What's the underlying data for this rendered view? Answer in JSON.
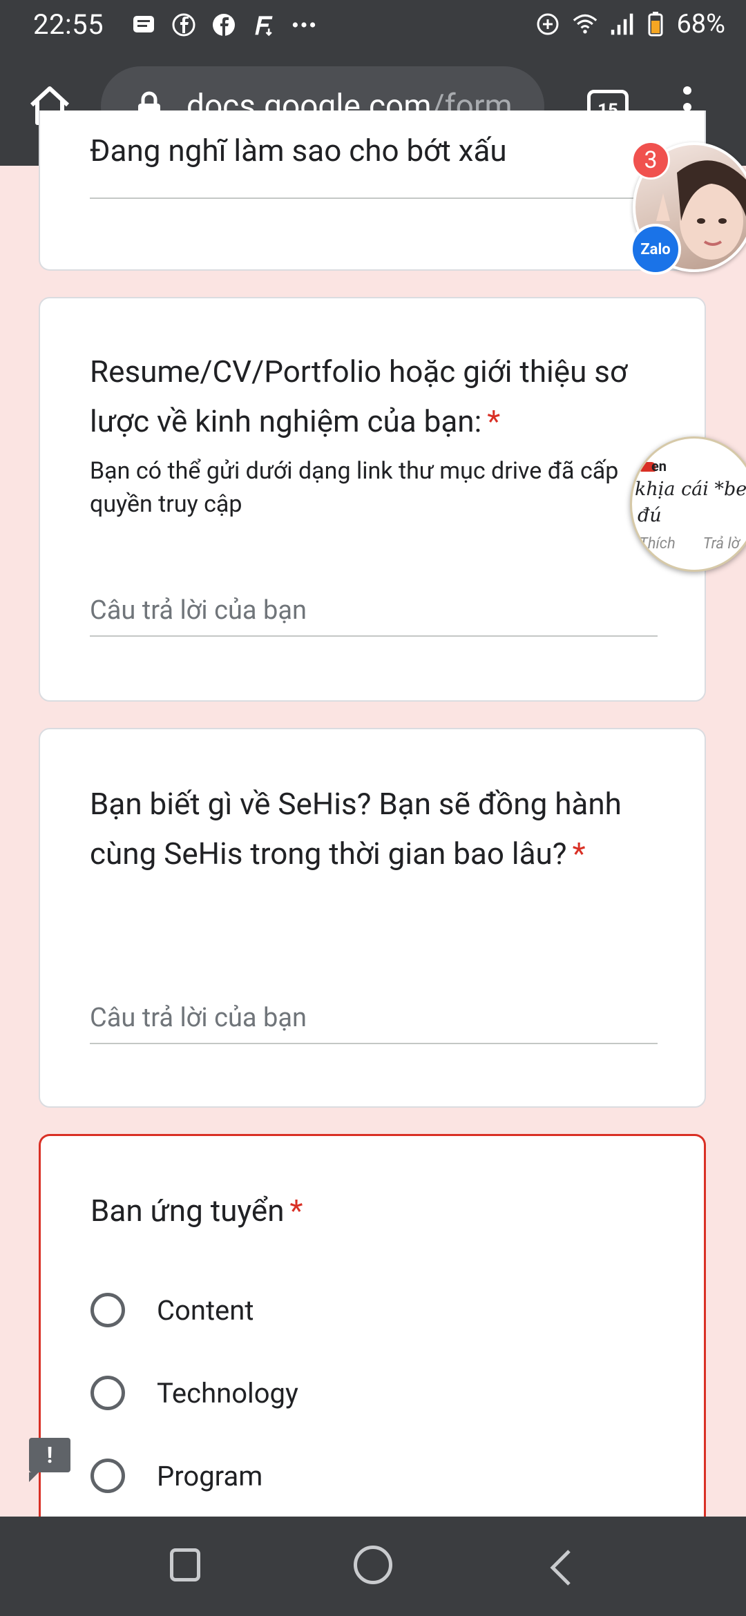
{
  "status_bar": {
    "time": "22:55",
    "battery": "68%",
    "left_icons": [
      "message-icon",
      "facebook-outline-icon",
      "facebook-icon",
      "f-app-icon",
      "more-dots-icon"
    ],
    "right_icons": [
      "data-saver-icon",
      "wifi-icon",
      "signal-icon",
      "battery-icon"
    ]
  },
  "browser": {
    "url_host": "docs.google.com",
    "url_path": "/form",
    "tab_count": "15"
  },
  "form": {
    "prev_answer": "Đang nghĩ làm sao cho bớt xấu",
    "q_resume": {
      "title": "Resume/CV/Portfolio hoặc giới thiệu sơ lược về kinh nghiệm của bạn:",
      "required": "*",
      "description": "Bạn có thể gửi dưới dạng link thư mục drive đã cấp quyền truy cập",
      "placeholder": "Câu trả lời của bạn"
    },
    "q_sehis": {
      "title": "Bạn biết gì về SeHis? Bạn sẽ đồng hành cùng SeHis trong thời gian bao lâu?",
      "required": "*",
      "placeholder": "Câu trả lời của bạn"
    },
    "q_ban": {
      "title": "Ban ứng tuyển",
      "required": "*",
      "options": [
        "Content",
        "Technology",
        "Program"
      ]
    }
  },
  "overlays": {
    "zalo_badge": "3",
    "zalo_logo": "Zalo",
    "chat_line1": "en",
    "chat_line2": "khịa cái *beep",
    "chat_line3": "đú",
    "chat_like": "Thích",
    "chat_reply": "Trả lờ",
    "feedback": "!"
  }
}
